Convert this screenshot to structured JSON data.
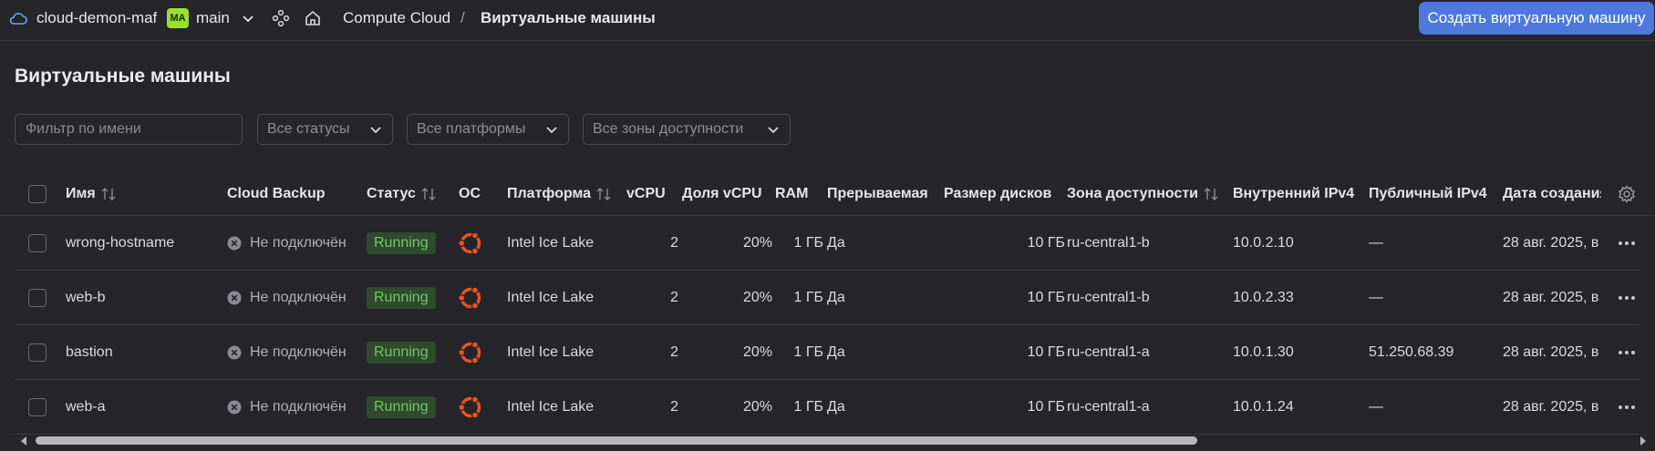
{
  "header": {
    "cloud_name": "cloud-demon-maf",
    "workspace_badge": "MA",
    "folder_name": "main",
    "service": "Compute Cloud",
    "separator": "/",
    "current_page": "Виртуальные машины",
    "create_button": "Создать виртуальную машину"
  },
  "page": {
    "title": "Виртуальные машины"
  },
  "filters": {
    "name_placeholder": "Фильтр по имени",
    "status_select": "Все статусы",
    "platform_select": "Все платформы",
    "zone_select": "Все зоны доступности"
  },
  "table": {
    "columns": {
      "name": "Имя",
      "backup": "Cloud Backup",
      "status": "Статус",
      "os": "ОС",
      "platform": "Платформа",
      "vcpu": "vCPU",
      "vcpu_share": "Доля vCPU",
      "ram": "RAM",
      "preemptible": "Прерываемая",
      "disk_size": "Размер дисков",
      "zone": "Зона доступности",
      "internal_ip": "Внутренний IPv4",
      "public_ip": "Публичный IPv4",
      "created": "Дата создания"
    },
    "rows": [
      {
        "name": "wrong-hostname",
        "backup": "Не подключён",
        "status": "Running",
        "os_icon": "ubuntu-icon",
        "platform": "Intel Ice Lake",
        "vcpu": "2",
        "vcpu_share": "20%",
        "ram": "1 ГБ",
        "preemptible": "Да",
        "disk": "10 ГБ",
        "zone": "ru-central1-b",
        "internal_ip": "10.0.2.10",
        "public_ip": "—",
        "created": "28 авг. 2025, в"
      },
      {
        "name": "web-b",
        "backup": "Не подключён",
        "status": "Running",
        "os_icon": "ubuntu-icon",
        "platform": "Intel Ice Lake",
        "vcpu": "2",
        "vcpu_share": "20%",
        "ram": "1 ГБ",
        "preemptible": "Да",
        "disk": "10 ГБ",
        "zone": "ru-central1-b",
        "internal_ip": "10.0.2.33",
        "public_ip": "—",
        "created": "28 авг. 2025, в"
      },
      {
        "name": "bastion",
        "backup": "Не подключён",
        "status": "Running",
        "os_icon": "ubuntu-icon",
        "platform": "Intel Ice Lake",
        "vcpu": "2",
        "vcpu_share": "20%",
        "ram": "1 ГБ",
        "preemptible": "Да",
        "disk": "10 ГБ",
        "zone": "ru-central1-a",
        "internal_ip": "10.0.1.30",
        "public_ip": "51.250.68.39",
        "created": "28 авг. 2025, в"
      },
      {
        "name": "web-a",
        "backup": "Не подключён",
        "status": "Running",
        "os_icon": "ubuntu-icon",
        "platform": "Intel Ice Lake",
        "vcpu": "2",
        "vcpu_share": "20%",
        "ram": "1 ГБ",
        "preemptible": "Да",
        "disk": "10 ГБ",
        "zone": "ru-central1-a",
        "internal_ip": "10.0.1.24",
        "public_ip": "—",
        "created": "28 авг. 2025, в"
      }
    ]
  },
  "colors": {
    "background": "#25252a",
    "accent": "#4e79dc",
    "badge": "#9be02e",
    "running_bg": "#2f4a2c",
    "running_text": "#73c56a",
    "ubuntu": "#e95420"
  }
}
